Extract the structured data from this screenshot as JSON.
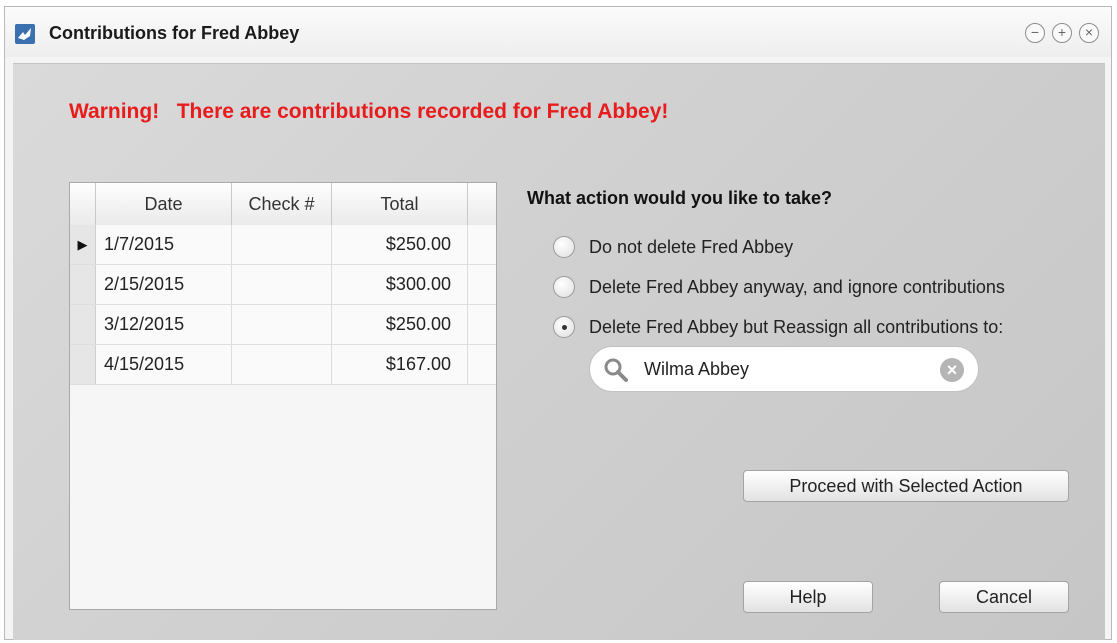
{
  "window": {
    "title": "Contributions for Fred Abbey",
    "controls": {
      "minimize": "−",
      "maximize": "+",
      "close": "×"
    }
  },
  "warning": {
    "prefix": "Warning!",
    "message": "There are contributions recorded for Fred Abbey!"
  },
  "table": {
    "columns": [
      "Date",
      "Check #",
      "Total"
    ],
    "rows": [
      {
        "date": "1/7/2015",
        "check": "",
        "total": "$250.00",
        "current": true
      },
      {
        "date": "2/15/2015",
        "check": "",
        "total": "$300.00",
        "current": false
      },
      {
        "date": "3/12/2015",
        "check": "",
        "total": "$250.00",
        "current": false
      },
      {
        "date": "4/15/2015",
        "check": "",
        "total": "$167.00",
        "current": false
      }
    ],
    "current_row_marker": "▶"
  },
  "actions": {
    "question": "What action would you like to take?",
    "options": [
      {
        "label": "Do not delete Fred Abbey",
        "selected": false
      },
      {
        "label": "Delete Fred Abbey anyway, and ignore contributions",
        "selected": false
      },
      {
        "label": "Delete Fred Abbey but Reassign all contributions to:",
        "selected": true
      }
    ],
    "reassign_to": "Wilma Abbey"
  },
  "buttons": {
    "proceed": "Proceed with Selected Action",
    "help": "Help",
    "cancel": "Cancel"
  },
  "colors": {
    "warning": "#e81c1c",
    "app_icon": "#3a6fb0"
  }
}
